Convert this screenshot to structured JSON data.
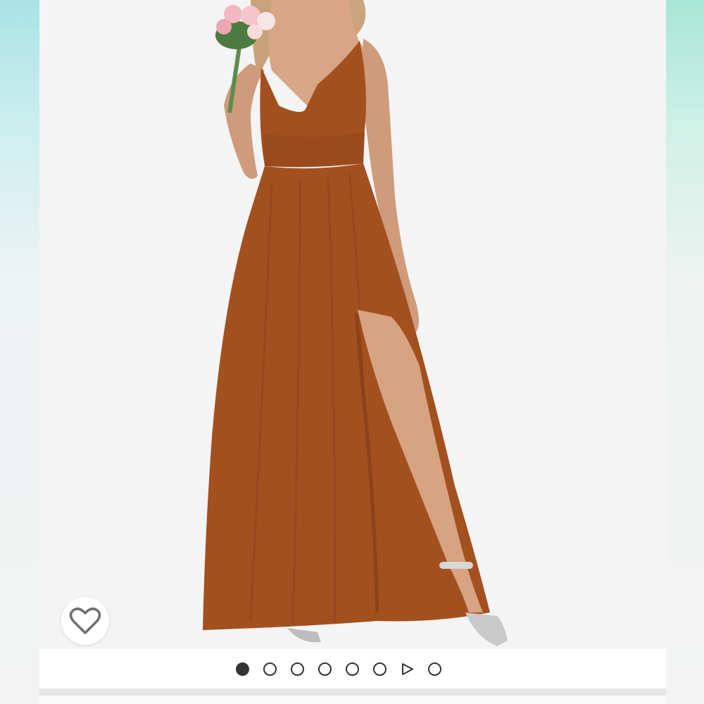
{
  "product": {
    "image_subject": "dress-photo",
    "dress_color": "#a3501f",
    "background_color": "#f4f4f4"
  },
  "favorite": {
    "icon": "heart-outline-icon",
    "icon_color": "#6f6f6f"
  },
  "carousel": {
    "total_items": 8,
    "active_index": 0,
    "items": [
      {
        "type": "image",
        "active": true
      },
      {
        "type": "image",
        "active": false
      },
      {
        "type": "image",
        "active": false
      },
      {
        "type": "image",
        "active": false
      },
      {
        "type": "image",
        "active": false
      },
      {
        "type": "image",
        "active": false
      },
      {
        "type": "video",
        "active": false
      },
      {
        "type": "image",
        "active": false
      }
    ],
    "dot_color": "#333333"
  }
}
